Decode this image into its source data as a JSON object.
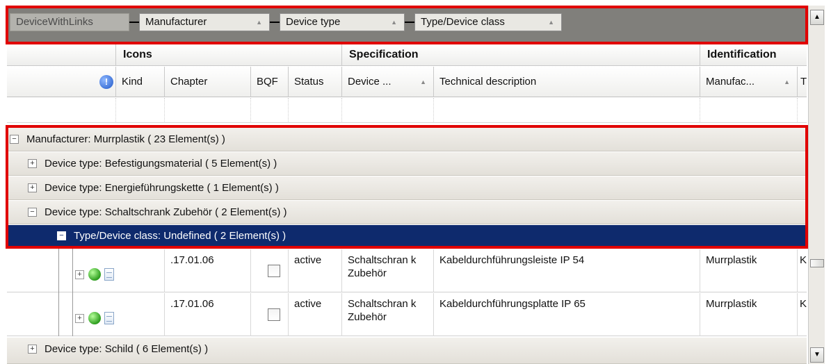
{
  "groupby": {
    "root": "DeviceWithLinks",
    "chips": [
      {
        "label": "Manufacturer"
      },
      {
        "label": "Device type"
      },
      {
        "label": "Type/Device class"
      }
    ],
    "sort_glyph": "▲"
  },
  "bands": {
    "icons": "Icons",
    "specification": "Specification",
    "identification": "Identification"
  },
  "columns": {
    "kind": "Kind",
    "chapter": "Chapter",
    "bqf": "BQF",
    "status": "Status",
    "device": "Device ...",
    "technical_description": "Technical description",
    "manufacturer": "Manufac...",
    "overflow": "T",
    "sort_glyph": "▲"
  },
  "info_icon_glyph": "!",
  "groups": {
    "manufacturer": "Manufacturer:  Murrplastik  ( 23 Element(s) )",
    "device_type_1": "Device type:  Befestigungsmaterial  ( 5 Element(s) )",
    "device_type_2": "Device type:  Energieführungskette  ( 1 Element(s) )",
    "device_type_3": "Device type:  Schaltschrank Zubehör  ( 2 Element(s) )",
    "type_class": "Type/Device class:  Undefined  ( 2 Element(s) )",
    "device_type_4": "Device type:  Schild  ( 6 Element(s) )"
  },
  "expander": {
    "collapsed": "+",
    "expanded": "−"
  },
  "rows": [
    {
      "chapter": ".17.01.06",
      "status": "active",
      "device_type": "Schaltschran k Zubehör",
      "technical_description": "Kabeldurchführungsleiste IP 54",
      "manufacturer": "Murrplastik",
      "overflow": "K"
    },
    {
      "chapter": ".17.01.06",
      "status": "active",
      "device_type": "Schaltschran k Zubehör",
      "technical_description": "Kabeldurchführungsplatte IP 65",
      "manufacturer": "Murrplastik",
      "overflow": "K"
    }
  ],
  "scrollbar": {
    "up": "▲",
    "down": "▼"
  },
  "colors": {
    "selected_row": "#0e2a6d",
    "highlight": "#e10000",
    "groupby_panel": "#807f7b"
  }
}
